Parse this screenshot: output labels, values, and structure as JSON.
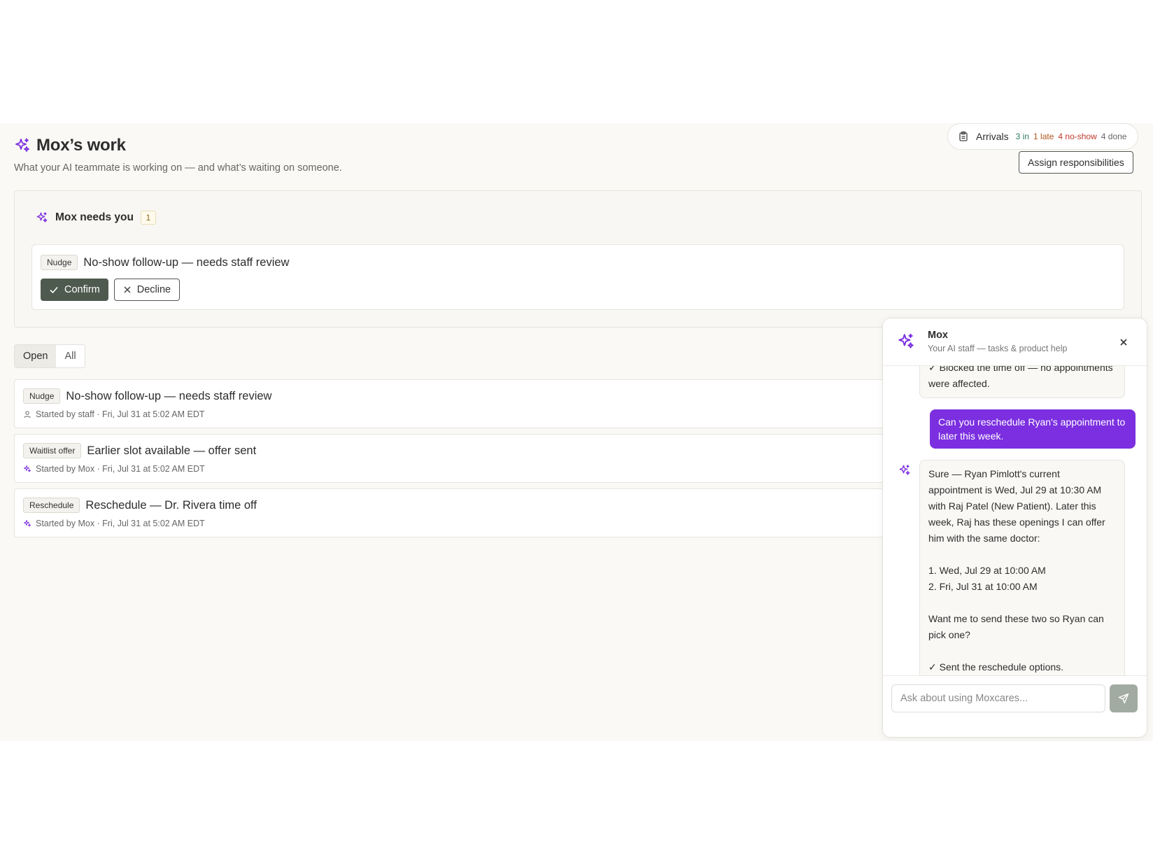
{
  "header": {
    "title": "Mox’s work",
    "subtitle": "What your AI teammate is working on — and what’s waiting on someone."
  },
  "arrivals": {
    "label": "Arrivals",
    "in": "3 in",
    "late": "1 late",
    "no_show": "4 no-show",
    "done": "4 done"
  },
  "assign_label": "Assign responsibilities",
  "needs_you": {
    "title": "Mox needs you",
    "count": "1",
    "item": {
      "tag": "Nudge",
      "title": "No-show follow-up — needs staff review",
      "confirm_label": "Confirm",
      "decline_label": "Decline"
    }
  },
  "filters": [
    "Open",
    "All"
  ],
  "tasks": [
    {
      "tag": "Nudge",
      "title": "No-show follow-up — needs staff review",
      "meta": "Started by staff · Fri, Jul 31 at 5:02 AM EDT",
      "icon": "person-icon"
    },
    {
      "tag": "Waitlist offer",
      "title": "Earlier slot available — offer sent",
      "meta": "Started by Mox · Fri, Jul 31 at 5:02 AM EDT",
      "icon": "sparkle-icon"
    },
    {
      "tag": "Reschedule",
      "title": "Reschedule — Dr. Rivera time off",
      "meta": "Started by Mox · Fri, Jul 31 at 5:02 AM EDT",
      "icon": "sparkle-icon"
    }
  ],
  "chat": {
    "name": "Mox",
    "desc": "Your AI staff — tasks & product help",
    "prev_message": "✓ Blocked the time off — no appointments were affected.",
    "user_message": "Can you reschedule Ryan's appointment to later this week.",
    "bot_message": "Sure — Ryan Pimlott's current appointment is Wed, Jul 29 at 10:30 AM with Raj Patel (New Patient). Later this week, Raj has these openings I can offer him with the same doctor:\n\n1. Wed, Jul 29 at 10:00 AM\n2. Fri, Jul 31 at 10:00 AM\n\nWant me to send these two so Ryan can pick one?\n\n✓ Sent the reschedule options.",
    "input_placeholder": "Ask about using Moxcares..."
  },
  "colors": {
    "accent_purple": "#7b2fe0",
    "confirm_bg": "#4f5a4f",
    "page_bg": "#faf9f6"
  }
}
